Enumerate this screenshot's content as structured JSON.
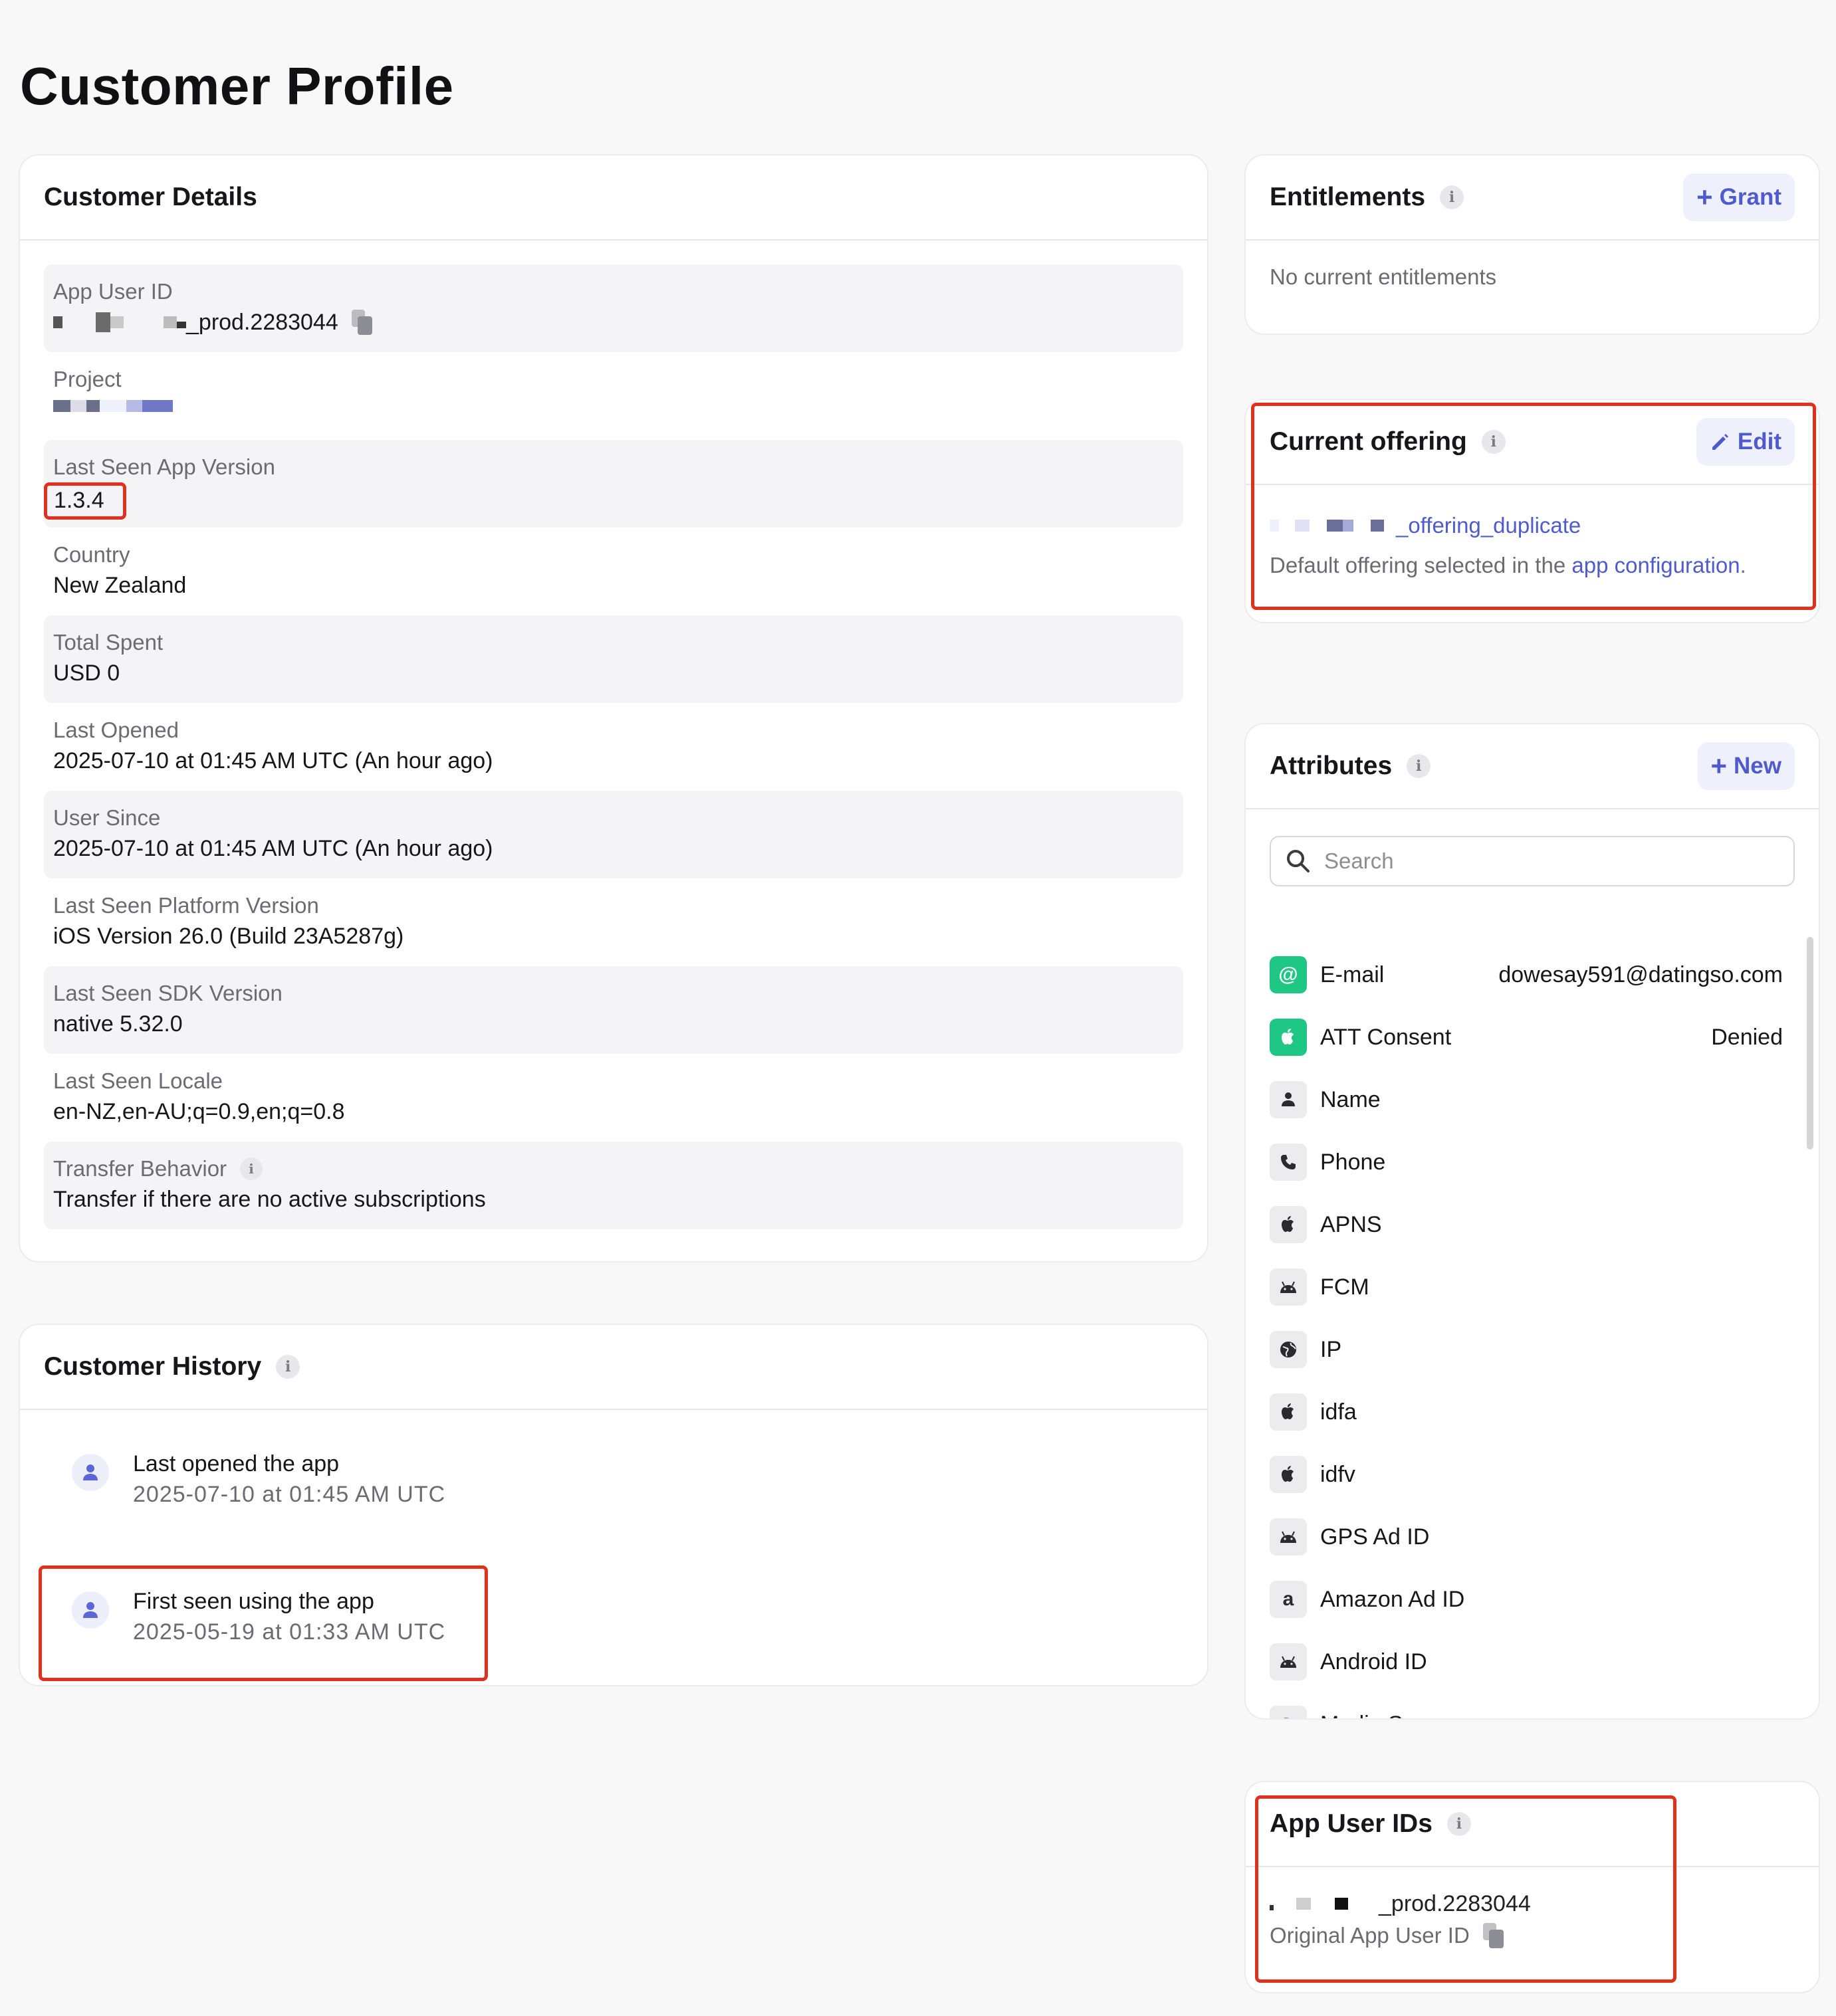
{
  "page": {
    "title": "Customer Profile"
  },
  "customer_details": {
    "title": "Customer Details",
    "rows": [
      {
        "label": "App User ID",
        "value": "_prod.2283044"
      },
      {
        "label": "Project",
        "value": ""
      },
      {
        "label": "Last Seen App Version",
        "value": "1.3.4"
      },
      {
        "label": "Country",
        "value": "New Zealand"
      },
      {
        "label": "Total Spent",
        "value": "USD 0"
      },
      {
        "label": "Last Opened",
        "value": "2025-07-10 at 01:45 AM UTC (An hour ago)"
      },
      {
        "label": "User Since",
        "value": "2025-07-10 at 01:45 AM UTC (An hour ago)"
      },
      {
        "label": "Last Seen Platform Version",
        "value": "iOS Version 26.0 (Build 23A5287g)"
      },
      {
        "label": "Last Seen SDK Version",
        "value": "native 5.32.0"
      },
      {
        "label": "Last Seen Locale",
        "value": "en-NZ,en-AU;q=0.9,en;q=0.8"
      },
      {
        "label": "Transfer Behavior",
        "value": "Transfer if there are no active subscriptions"
      }
    ]
  },
  "customer_history": {
    "title": "Customer History",
    "items": [
      {
        "title": "Last opened the app",
        "date": "2025-07-10 at 01:45 AM UTC"
      },
      {
        "title": "First seen using the app",
        "date": "2025-05-19 at 01:33 AM UTC"
      }
    ]
  },
  "entitlements": {
    "title": "Entitlements",
    "button": "Grant",
    "empty_text": "No current entitlements"
  },
  "current_offering": {
    "title": "Current offering",
    "button": "Edit",
    "offering_id": "_offering_duplicate",
    "desc_prefix": "Default offering selected in the ",
    "desc_link": "app configuration",
    "desc_suffix": "."
  },
  "attributes": {
    "title": "Attributes",
    "button": "New",
    "search_placeholder": "Search",
    "items": [
      {
        "icon": "at-icon",
        "glyph": "@",
        "style": "green",
        "name": "E-mail",
        "value": "dowesay591@datingso.com"
      },
      {
        "icon": "apple-icon",
        "glyph": "",
        "style": "green",
        "name": "ATT Consent",
        "value": "Denied"
      },
      {
        "icon": "person-icon",
        "glyph": "",
        "style": "",
        "name": "Name",
        "value": ""
      },
      {
        "icon": "phone-icon",
        "glyph": "",
        "style": "",
        "name": "Phone",
        "value": ""
      },
      {
        "icon": "apple-icon",
        "glyph": "",
        "style": "",
        "name": "APNS",
        "value": ""
      },
      {
        "icon": "android-icon",
        "glyph": "",
        "style": "",
        "name": "FCM",
        "value": ""
      },
      {
        "icon": "globe-icon",
        "glyph": "",
        "style": "",
        "name": "IP",
        "value": ""
      },
      {
        "icon": "apple-icon",
        "glyph": "",
        "style": "",
        "name": "idfa",
        "value": ""
      },
      {
        "icon": "apple-icon",
        "glyph": "",
        "style": "",
        "name": "idfv",
        "value": ""
      },
      {
        "icon": "android-icon",
        "glyph": "",
        "style": "",
        "name": "GPS Ad ID",
        "value": ""
      },
      {
        "icon": "amazon-icon",
        "glyph": "a",
        "style": "",
        "name": "Amazon Ad ID",
        "value": ""
      },
      {
        "icon": "android-icon",
        "glyph": "",
        "style": "",
        "name": "Android ID",
        "value": ""
      },
      {
        "icon": "media-source-icon",
        "glyph": "",
        "style": "",
        "name": "Media Source",
        "value": ""
      }
    ]
  },
  "app_user_ids": {
    "title": "App User IDs",
    "id_value": "_prod.2283044",
    "id_caption": "Original App User ID"
  },
  "colors": {
    "accent": "#4f5bcc",
    "highlight": "#e0301e",
    "success": "#1ec783"
  }
}
